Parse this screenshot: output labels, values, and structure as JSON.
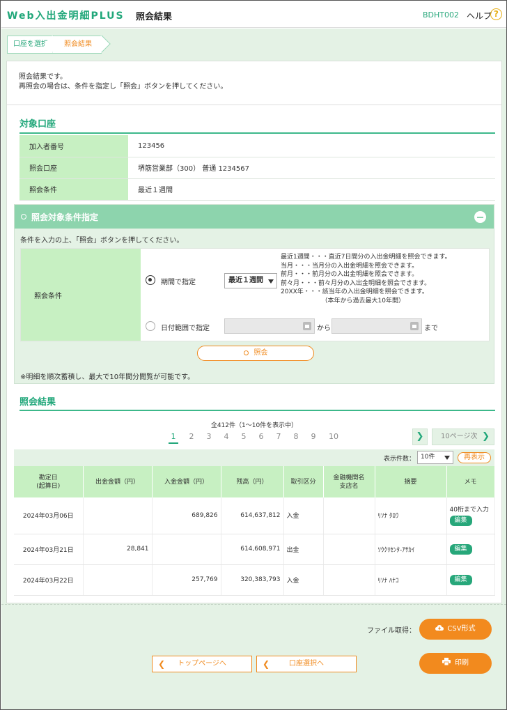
{
  "header": {
    "app_title": "Web入出金明細PLUS",
    "page_title": "照会結果",
    "screen_id": "BDHT002",
    "help_label": "ヘルプ",
    "help_icon_glyph": "?"
  },
  "breadcrumb": {
    "step1": "口座を選択",
    "step2": "照会結果"
  },
  "intro": {
    "line1": "照会結果です。",
    "line2": "再照会の場合は、条件を指定し「照会」ボタンを押してください。"
  },
  "account_section": {
    "title": "対象口座",
    "rows": [
      {
        "label": "加入者番号",
        "value": "123456"
      },
      {
        "label": "照会口座",
        "value": "堺筋営業部（300） 普通 1234567"
      },
      {
        "label": "照会条件",
        "value": "最近１週間"
      }
    ]
  },
  "condition_panel": {
    "title": "照会対象条件指定",
    "description": "条件を入力の上、「照会」ボタンを押してください。",
    "label": "照会条件",
    "option_period": "期間で指定",
    "option_range": "日付範囲で指定",
    "period_select_value": "最近１週間",
    "period_note": "最近1週間・・・直近7日間分の入出金明細を照会できます。\n当月・・・当月分の入出金明細を照会できます。\n前月・・・前月分の入出金明細を照会できます。\n前々月・・・前々月分の入出金明細を照会できます。\n20XX年・・・該当年の入出金明細を照会できます。\n　　　　　　　（本年から過去最大10年間）",
    "from_text": "から",
    "to_text": "まで",
    "search_button": "照会",
    "footnote": "※明細を順次蓄積し、最大で10年間分閲覧が可能です。"
  },
  "results": {
    "title": "照会結果",
    "summary": "全412件（1～10件を表示中）",
    "pages": [
      "1",
      "2",
      "3",
      "4",
      "5",
      "6",
      "7",
      "8",
      "9",
      "10"
    ],
    "current_page": "1",
    "next_arrow": "❯",
    "next10_label": "10ページ次",
    "per_page_label": "表示件数：",
    "per_page_value": "10件",
    "redisplay_button": "再表示",
    "columns": {
      "date1": "勘定日",
      "date2": "(起算日)",
      "withdrawal": "出金金額（円）",
      "deposit": "入金金額（円）",
      "balance": "残高（円）",
      "type": "取引区分",
      "bank1": "金融機関名",
      "bank2": "支店名",
      "summary": "摘要",
      "memo": "メモ"
    },
    "rows": [
      {
        "date": "2024年03月06日",
        "withdrawal": "",
        "deposit": "689,826",
        "balance": "614,637,812",
        "type": "入金",
        "bank": "",
        "summary": "ﾘｿﾅ ﾀﾛｳ",
        "memo": "40桁まで入力",
        "edit": "編集"
      },
      {
        "date": "2024年03月21日",
        "withdrawal": "28,841",
        "deposit": "",
        "balance": "614,608,971",
        "type": "出金",
        "bank": "",
        "summary": "ｿｳｸﾘｾﾝﾀ-ｱｻｶｲ",
        "memo": "",
        "edit": "編集"
      },
      {
        "date": "2024年03月22日",
        "withdrawal": "",
        "deposit": "257,769",
        "balance": "320,383,793",
        "type": "入金",
        "bank": "",
        "summary": "ﾘｿﾅ ﾊﾅｺ",
        "memo": "",
        "edit": "編集"
      }
    ]
  },
  "footer": {
    "file_label": "ファイル取得：",
    "csv_button": "CSV形式",
    "print_button": "印刷",
    "top_button": "トップページへ",
    "account_select_button": "口座選択へ",
    "back_arrow": "❮"
  },
  "colors": {
    "accent": "#21a77a",
    "orange": "#f28a1e",
    "table_header": "#c7f0c2",
    "page_bg": "#e4f2e5"
  }
}
